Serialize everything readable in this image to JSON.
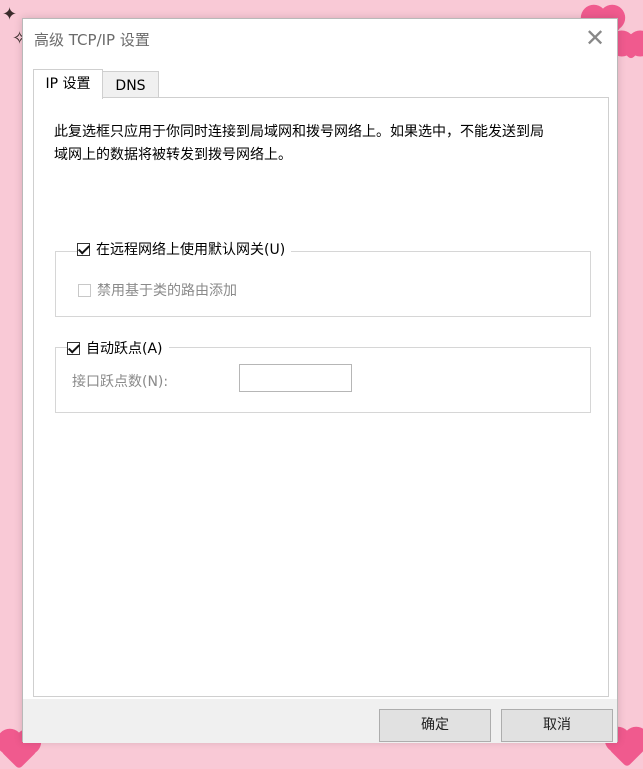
{
  "window": {
    "title": "高级 TCP/IP 设置",
    "close_glyph": "✕"
  },
  "tabs": [
    {
      "label": "IP 设置",
      "active": true
    },
    {
      "label": "DNS",
      "active": false
    }
  ],
  "description": "此复选框只应用于你同时连接到局域网和拨号网络上。如果选中，不能发送到局域网上的数据将被转发到拨号网络上。",
  "gateway_group": {
    "label": "在远程网络上使用默认网关(U)",
    "checked": true,
    "sub_option": {
      "label": "禁用基于类的路由添加",
      "checked": false,
      "enabled": false
    }
  },
  "metric_group": {
    "label": "自动跃点(A)",
    "checked": true,
    "interface_metric_label": "接口跃点数(N):",
    "interface_metric_value": ""
  },
  "buttons": {
    "ok": "确定",
    "cancel": "取消"
  },
  "icons": {
    "close": "close-icon",
    "checkmark": "checkmark-icon"
  },
  "colors": {
    "desktop_bg": "#f9c9d6",
    "decor_heart": "#f05a8e",
    "footer_bg": "#f0f0f0"
  }
}
